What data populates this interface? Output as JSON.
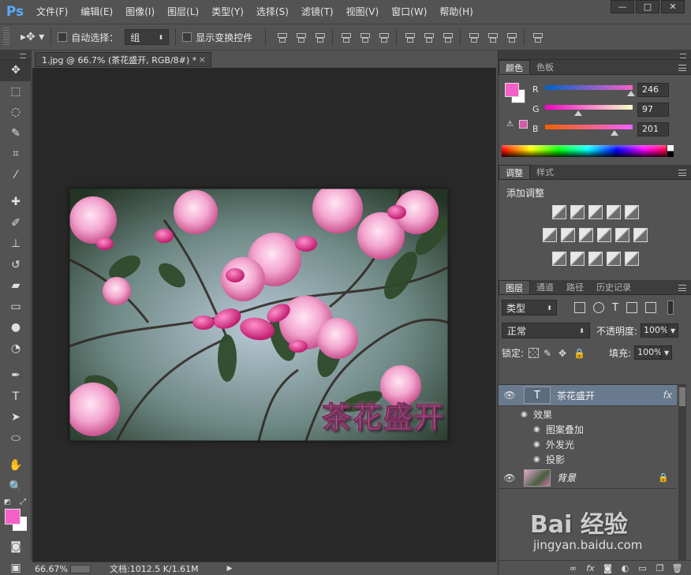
{
  "app": {
    "logo": "Ps",
    "menu": [
      "文件(F)",
      "编辑(E)",
      "图像(I)",
      "图层(L)",
      "类型(Y)",
      "选择(S)",
      "滤镜(T)",
      "视图(V)",
      "窗口(W)",
      "帮助(H)"
    ],
    "window_controls": [
      "—",
      "□",
      "✕"
    ]
  },
  "options_bar": {
    "auto_select_label": "自动选择：",
    "auto_select_value": "组",
    "show_transform_label": "显示变换控件"
  },
  "document": {
    "tab_title": "1.jpg @ 66.7% (茶花盛开, RGB/8#) *",
    "close": "×",
    "image_text": "茶花盛开",
    "zoom": "66.67%",
    "doc_size": "文档:1012.5 K/1.61M"
  },
  "color_panel": {
    "tabs": [
      "颜色",
      "色板"
    ],
    "fg_color": "#f661c9",
    "bg_color": "#ffffff",
    "channels": [
      {
        "label": "R",
        "value": "246"
      },
      {
        "label": "G",
        "value": "97"
      },
      {
        "label": "B",
        "value": "201"
      }
    ]
  },
  "adjustments_panel": {
    "tabs": [
      "调整",
      "样式"
    ],
    "title": "添加调整"
  },
  "layers_panel": {
    "tabs": [
      "图层",
      "通道",
      "路径",
      "历史记录"
    ],
    "filter_value": "类型",
    "blend_mode": "正常",
    "opacity_label": "不透明度:",
    "opacity_value": "100%",
    "lock_label": "锁定:",
    "fill_label": "填充:",
    "fill_value": "100%",
    "layers": [
      {
        "name": "茶花盛开",
        "thumb": "T",
        "fx": "fx"
      },
      {
        "name": "背景"
      }
    ],
    "effects_label": "效果",
    "effects": [
      "图案叠加",
      "外发光",
      "投影"
    ]
  },
  "watermark": {
    "main": "Bai  经验",
    "url": "jingyan.baidu.com"
  }
}
